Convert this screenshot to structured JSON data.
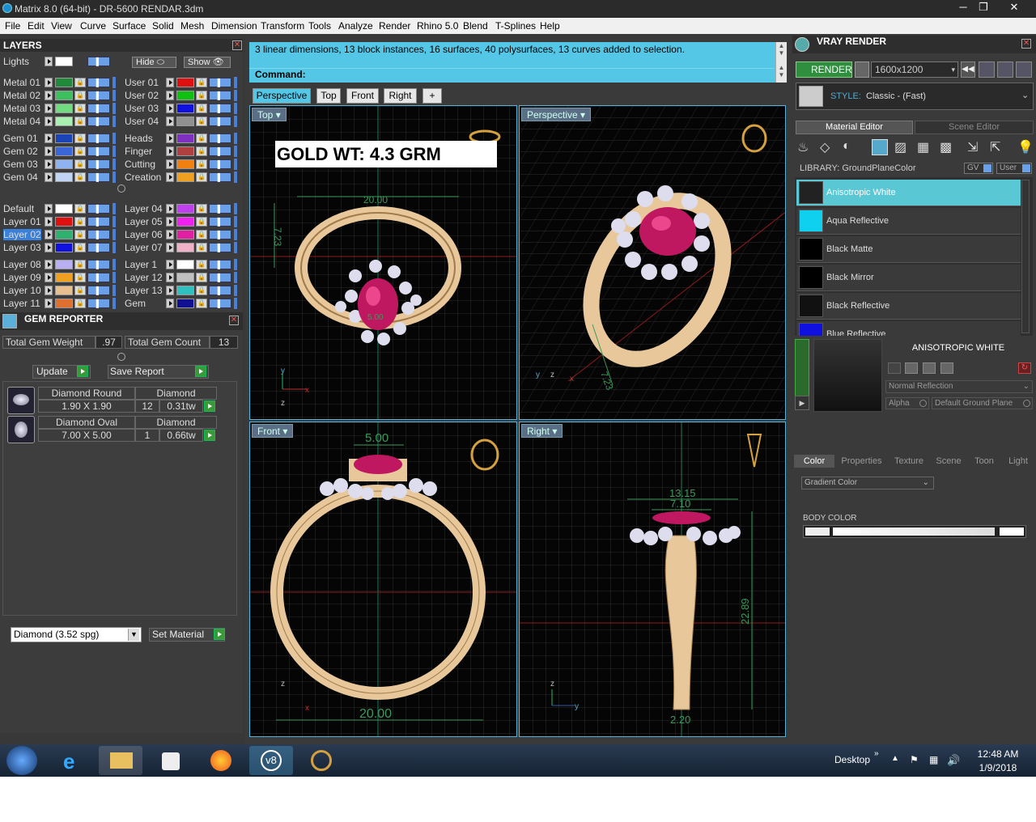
{
  "titlebar": {
    "title": "Matrix 8.0 (64-bit) - DR-5600 RENDAR.3dm"
  },
  "menu": [
    "File",
    "Edit",
    "View",
    "Curve",
    "Surface",
    "Solid",
    "Mesh",
    "Dimension",
    "Transform",
    "Tools",
    "Analyze",
    "Render",
    "Rhino 5.0",
    "Blend",
    "T-Splines",
    "Help"
  ],
  "layers": {
    "title": "LAYERS",
    "lights": "Lights",
    "hide": "Hide",
    "show": "Show",
    "left": [
      {
        "name": "Metal 01",
        "color": "#1e8a3a"
      },
      {
        "name": "Metal 02",
        "color": "#3cbf5e"
      },
      {
        "name": "Metal 03",
        "color": "#6fdc7f"
      },
      {
        "name": "Metal 04",
        "color": "#a8f0b0"
      },
      {
        "name": "Gem 01",
        "color": "#1a44b8"
      },
      {
        "name": "Gem 02",
        "color": "#3a66d8"
      },
      {
        "name": "Gem 03",
        "color": "#8fb2f0"
      },
      {
        "name": "Gem 04",
        "color": "#c0d4f6"
      },
      {
        "name": "Default",
        "color": "#ffffff"
      },
      {
        "name": "Layer 01",
        "color": "#e01010"
      },
      {
        "name": "Layer 02",
        "color": "#30b070"
      },
      {
        "name": "Layer 03",
        "color": "#1010e0"
      },
      {
        "name": "Layer 08",
        "color": "#b8b0f0"
      },
      {
        "name": "Layer 09",
        "color": "#f0a020"
      },
      {
        "name": "Layer 10",
        "color": "#e8c090"
      },
      {
        "name": "Layer 11",
        "color": "#e07030"
      }
    ],
    "right": [
      {
        "name": "User 01",
        "color": "#e01010"
      },
      {
        "name": "User 02",
        "color": "#10c010"
      },
      {
        "name": "User 03",
        "color": "#1010e0"
      },
      {
        "name": "User 04",
        "color": "#909090"
      },
      {
        "name": "Heads",
        "color": "#8030c0"
      },
      {
        "name": "Finger",
        "color": "#b04040"
      },
      {
        "name": "Cutting",
        "color": "#f08010"
      },
      {
        "name": "Creation",
        "color": "#f0a020"
      },
      {
        "name": "Layer 04",
        "color": "#c040f0"
      },
      {
        "name": "Layer 05",
        "color": "#f020f0"
      },
      {
        "name": "Layer 06",
        "color": "#e020a0"
      },
      {
        "name": "Layer 07",
        "color": "#f0b0c8"
      },
      {
        "name": "Layer 1",
        "color": "#ffffff"
      },
      {
        "name": "Layer 12",
        "color": "#c0c0c0"
      },
      {
        "name": "Layer 13",
        "color": "#30c0c0"
      },
      {
        "name": "Gem",
        "color": "#101090"
      }
    ]
  },
  "gem": {
    "title": "GEM REPORTER",
    "total_weight_label": "Total Gem Weight",
    "total_weight": ".97",
    "total_count_label": "Total Gem Count",
    "total_count": "13",
    "update": "Update",
    "save": "Save Report",
    "rows": [
      {
        "shape": "Diamond Round",
        "material": "Diamond",
        "size": "1.90 X 1.90",
        "count": "12",
        "weight": "0.31tw"
      },
      {
        "shape": "Diamond Oval",
        "material": "Diamond",
        "size": "7.00 X 5.00",
        "count": "1",
        "weight": "0.66tw"
      }
    ],
    "select": "Diamond    (3.52 spg)",
    "set_material": "Set Material"
  },
  "command": {
    "history": "3 linear dimensions, 13 block instances, 16 surfaces, 40 polysurfaces, 13 curves added to selection.",
    "prompt": "Command:"
  },
  "viewtabs": [
    "Perspective",
    "Top",
    "Front",
    "Right",
    "+"
  ],
  "viewports": {
    "top": {
      "label": "Top",
      "annotation": "GOLD WT: 4.3 GRM",
      "dim1": "20.00",
      "dim2": "7.23",
      "dim3": "5.00"
    },
    "persp": {
      "label": "Perspective",
      "dim1": "7.23"
    },
    "front": {
      "label": "Front",
      "dim1": "5.00",
      "dim2": "20.00"
    },
    "right": {
      "label": "Right",
      "dim1": "13.15",
      "dim2": "7.10",
      "dim3": "22.89",
      "dim4": "2.20"
    }
  },
  "vray": {
    "title": "VRAY RENDER",
    "render": "RENDER",
    "resolution": "1600x1200",
    "style_label": "STYLE:",
    "style": "Classic - (Fast)",
    "tab1": "Material Editor",
    "tab2": "Scene Editor",
    "library": "LIBRARY: GroundPlaneColor",
    "gv": "GV",
    "user": "User",
    "materials": [
      {
        "name": "Anisotropic White",
        "color": "#222"
      },
      {
        "name": "Aqua Reflective",
        "color": "#10d0f0"
      },
      {
        "name": "Black Matte",
        "color": "#000"
      },
      {
        "name": "Black Mirror",
        "color": "#000"
      },
      {
        "name": "Black Reflective",
        "color": "#111"
      },
      {
        "name": "Blue Reflective",
        "color": "#1010e0"
      }
    ],
    "selected": "ANISOTROPIC WHITE",
    "reflection": "Normal Reflection",
    "alpha": "Alpha",
    "ground": "Default Ground Plane",
    "proptabs": [
      "Color",
      "Properties",
      "Texture",
      "Scene",
      "Toon",
      "Light"
    ],
    "gradient": "Gradient Color",
    "body_color": "BODY COLOR"
  },
  "taskbar": {
    "desktop": "Desktop",
    "time": "12:48 AM",
    "date": "1/9/2018"
  }
}
